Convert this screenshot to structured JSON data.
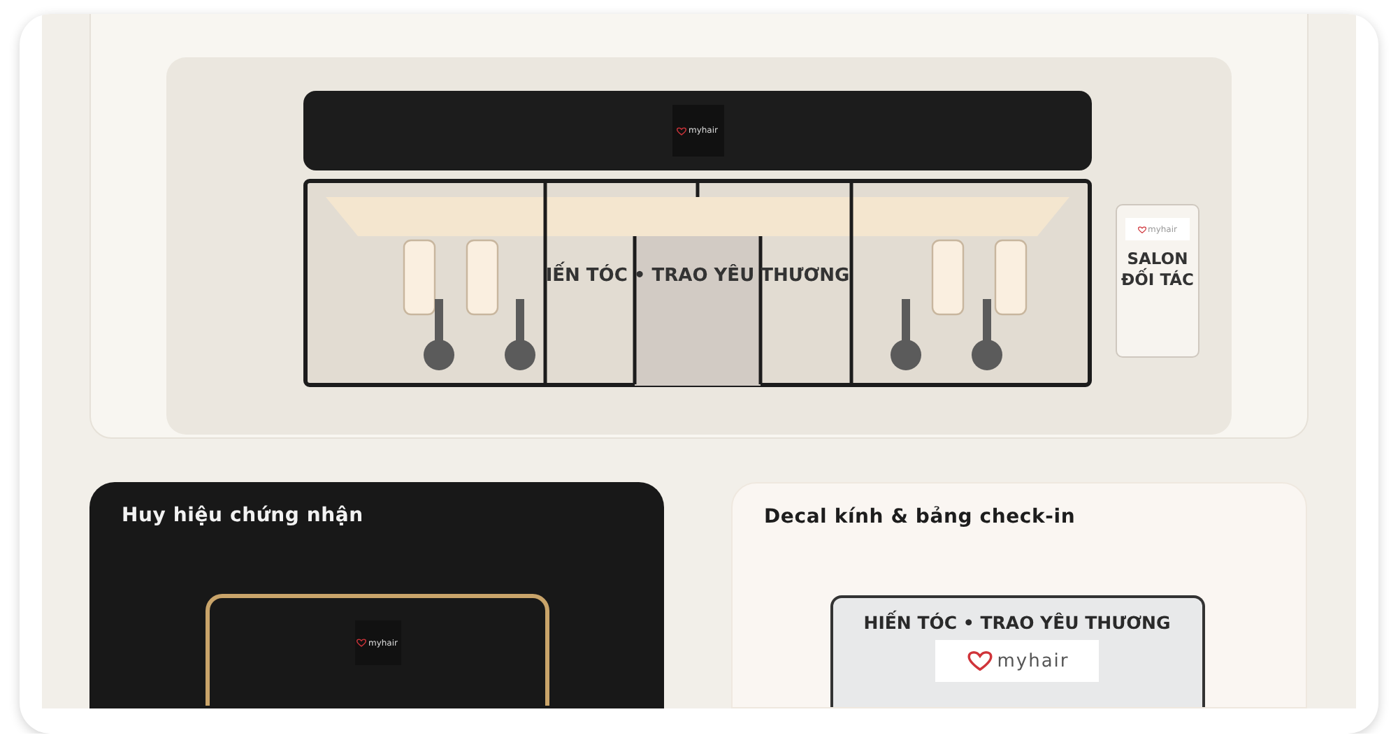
{
  "salon_front": {
    "header_logo": "myhair",
    "storefront_text": "IẾN TÓC • TRAO YÊU THƯƠNG",
    "side_sign": {
      "logo": "myhair",
      "label": "SALON ĐỐI TÁC"
    }
  },
  "cards": [
    {
      "kind": "badge",
      "title": "Huy hiệu chứng nhận",
      "logo": "myhair"
    },
    {
      "kind": "decal",
      "title": "Decal kính & bảng check-in",
      "sign_text": "HIẾN TÓC • TRAO YÊU THƯƠNG",
      "logo": "myhair"
    }
  ]
}
